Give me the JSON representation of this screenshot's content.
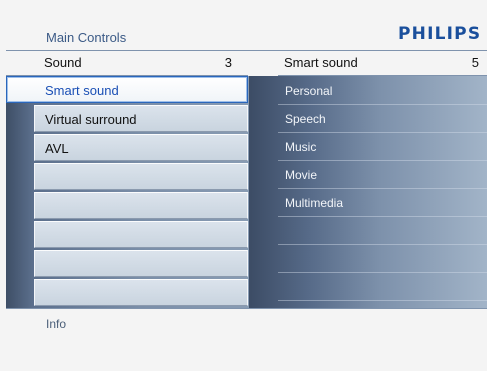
{
  "header": {
    "title": "Main Controls",
    "brand": "PHILIPS"
  },
  "left_menu": {
    "title": "Sound",
    "count": "3",
    "items": [
      {
        "label": "Smart sound",
        "selected": true
      },
      {
        "label": "Virtual surround",
        "selected": false
      },
      {
        "label": "AVL",
        "selected": false
      },
      {
        "label": "",
        "selected": false
      },
      {
        "label": "",
        "selected": false
      },
      {
        "label": "",
        "selected": false
      },
      {
        "label": "",
        "selected": false
      },
      {
        "label": "",
        "selected": false
      }
    ]
  },
  "right_menu": {
    "title": "Smart sound",
    "count": "5",
    "items": [
      {
        "label": "Personal"
      },
      {
        "label": "Speech"
      },
      {
        "label": "Music"
      },
      {
        "label": "Movie"
      },
      {
        "label": "Multimedia"
      },
      {
        "label": ""
      },
      {
        "label": ""
      },
      {
        "label": ""
      }
    ]
  },
  "footer": {
    "info": "Info"
  },
  "colors": {
    "brand": "#1a4f9c",
    "selection_border": "#2a66bb",
    "selection_text": "#1a4fb5"
  }
}
